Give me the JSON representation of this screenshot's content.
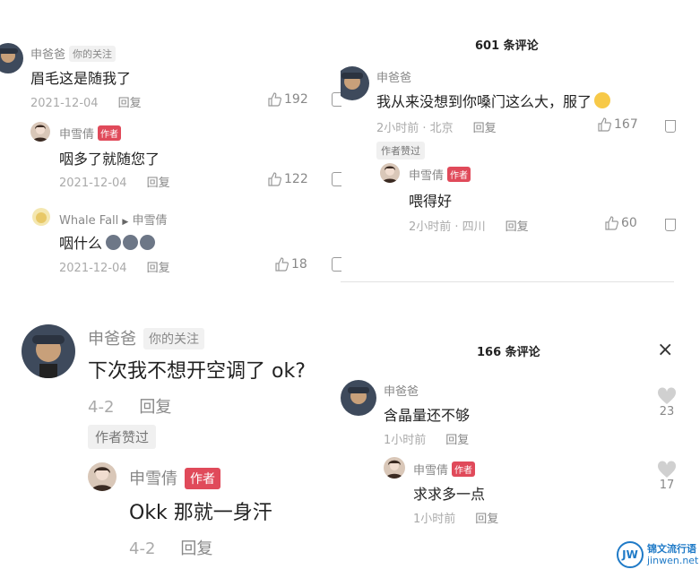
{
  "panel_a": {
    "c1": {
      "name": "申爸爸",
      "tag": "你的关注",
      "text": "眉毛这是随我了",
      "date": "2021-12-04",
      "reply": "回复",
      "likes": "192"
    },
    "c2": {
      "name": "申雪倩",
      "author": "作者",
      "text": "咽多了就随您了",
      "date": "2021-12-04",
      "reply": "回复",
      "likes": "122"
    },
    "c3": {
      "name": "Whale Fall",
      "arrow": "▶",
      "target": "申雪倩",
      "text": "咽什么",
      "date": "2021-12-04",
      "reply": "回复",
      "likes": "18"
    }
  },
  "panel_b": {
    "title": "601 条评论",
    "c1": {
      "name": "申爸爸",
      "text": "我从来没想到你嗓门这么大，服了",
      "meta": "2小时前 · 北京",
      "reply": "回复",
      "likes": "167",
      "liked_by_author": "作者赞过"
    },
    "c2": {
      "name": "申雪倩",
      "author": "作者",
      "text": "喂得好",
      "meta": "2小时前 · 四川",
      "reply": "回复",
      "likes": "60"
    }
  },
  "panel_c": {
    "c1": {
      "name": "申爸爸",
      "tag": "你的关注",
      "text": "下次我不想开空调了 ok?",
      "date": "4-2",
      "reply": "回复",
      "liked_by_author": "作者赞过"
    },
    "c2": {
      "name": "申雪倩",
      "author": "作者",
      "text": "Okk 那就一身汗",
      "date": "4-2",
      "reply": "回复"
    }
  },
  "panel_d": {
    "title": "166 条评论",
    "close": "×",
    "c1": {
      "name": "申爸爸",
      "text": "含晶量还不够",
      "meta": "1小时前",
      "reply": "回复",
      "likes": "23"
    },
    "c2": {
      "name": "申雪倩",
      "author": "作者",
      "text": "求求多一点",
      "meta": "1小时前",
      "reply": "回复",
      "likes": "17"
    }
  },
  "watermark": {
    "logo": "JW",
    "line1": "锦文流行语",
    "line2": "jinwen.net"
  }
}
